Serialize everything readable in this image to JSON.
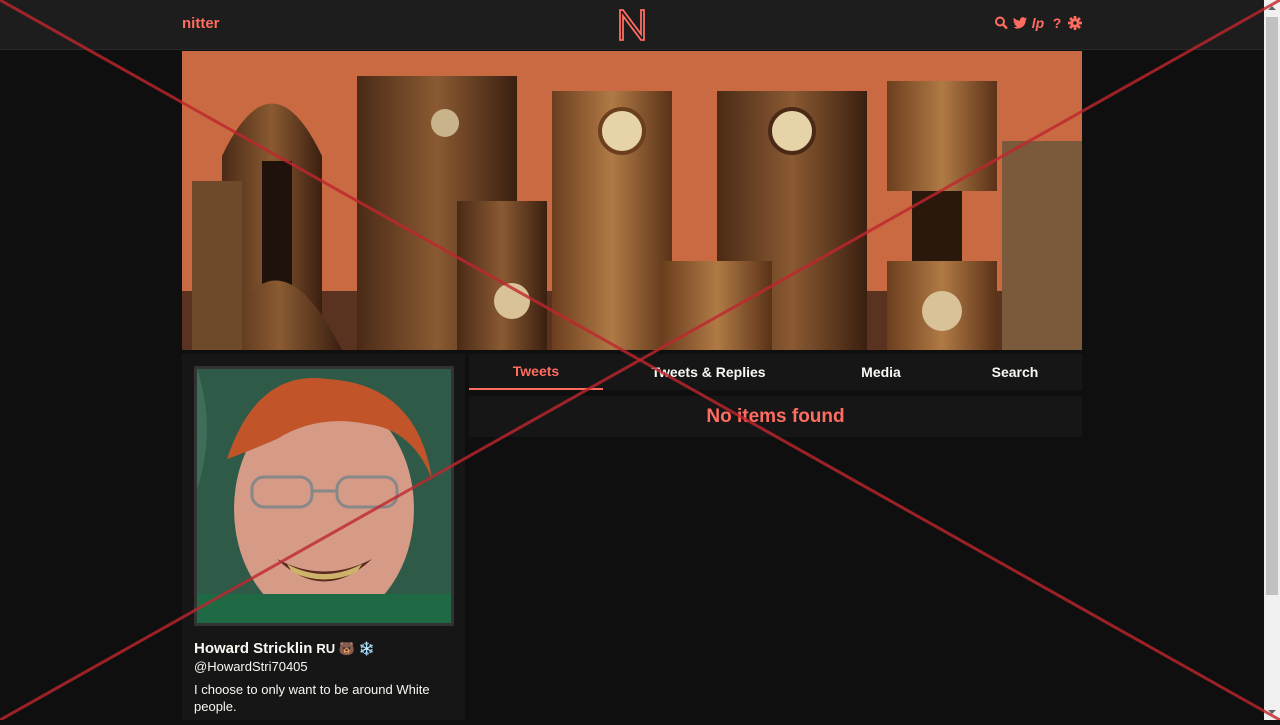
{
  "navbar": {
    "brand": "nitter",
    "logo_letter": "N",
    "icons": [
      "search-icon",
      "twitter-icon",
      "lp-icon",
      "help-icon",
      "gear-icon"
    ],
    "lp_label": "lp",
    "help_label": "?"
  },
  "profile": {
    "fullname": "Howard Stricklin",
    "name_extra": "RU 🐻 ❄️",
    "username": "@HowardStri70405",
    "bio": "I choose to only want to be around White people."
  },
  "tabs": [
    {
      "label": "Tweets",
      "active": true
    },
    {
      "label": "Tweets & Replies",
      "active": false
    },
    {
      "label": "Media",
      "active": false
    },
    {
      "label": "Search",
      "active": false
    }
  ],
  "timeline": {
    "empty_message": "No items found"
  },
  "colors": {
    "accent": "#ff6c60",
    "background": "#0f0f0f",
    "panel": "#161616",
    "navbar": "#1d1d1d"
  }
}
